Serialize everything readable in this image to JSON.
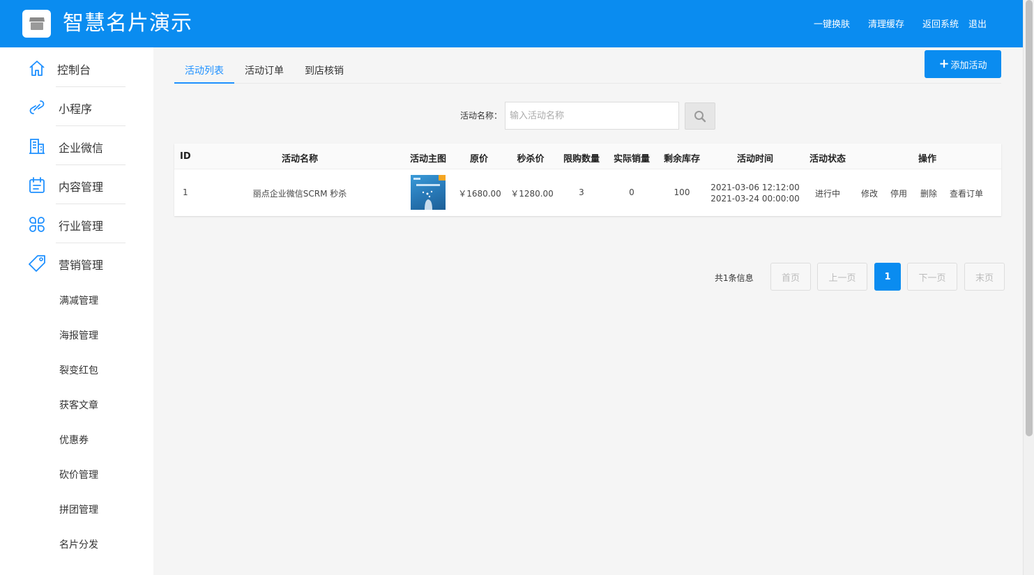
{
  "header": {
    "title": "智慧名片演示",
    "links": [
      "一键换肤",
      "清理缓存",
      "返回系统",
      "退出"
    ]
  },
  "sidebar": {
    "items": [
      {
        "label": "控制台",
        "icon": "home-icon"
      },
      {
        "label": "小程序",
        "icon": "link-icon"
      },
      {
        "label": "企业微信",
        "icon": "building-icon"
      },
      {
        "label": "内容管理",
        "icon": "clipboard-icon"
      },
      {
        "label": "行业管理",
        "icon": "clover-icon"
      },
      {
        "label": "营销管理",
        "icon": "tag-icon"
      }
    ],
    "subitems": [
      "满减管理",
      "海报管理",
      "裂变红包",
      "获客文章",
      "优惠券",
      "砍价管理",
      "拼团管理",
      "名片分发"
    ]
  },
  "tabs": [
    "活动列表",
    "活动订单",
    "到店核销"
  ],
  "add_button": "添加活动",
  "search": {
    "label": "活动名称：",
    "placeholder": "输入活动名称"
  },
  "table": {
    "columns": [
      "ID",
      "活动名称",
      "活动主图",
      "原价",
      "秒杀价",
      "限购数量",
      "实际销量",
      "剩余库存",
      "活动时间",
      "活动状态",
      "操作"
    ],
    "rows": [
      {
        "id": "1",
        "name": "丽点企业微信SCRM 秒杀",
        "price": "￥1680.00",
        "seckill_price": "￥1280.00",
        "limit": "3",
        "sold": "0",
        "stock": "100",
        "time_start": "2021-03-06 12:12:00",
        "time_end": "2021-03-24 00:00:00",
        "status": "进行中",
        "actions": [
          "修改",
          "停用",
          "删除",
          "查看订单"
        ]
      }
    ]
  },
  "pagination": {
    "total": "共1条信息",
    "first": "首页",
    "prev": "上一页",
    "current": "1",
    "next": "下一页",
    "last": "末页"
  },
  "colors": {
    "brand": "#0a8cf0",
    "active_tab": "#1e90ff"
  }
}
